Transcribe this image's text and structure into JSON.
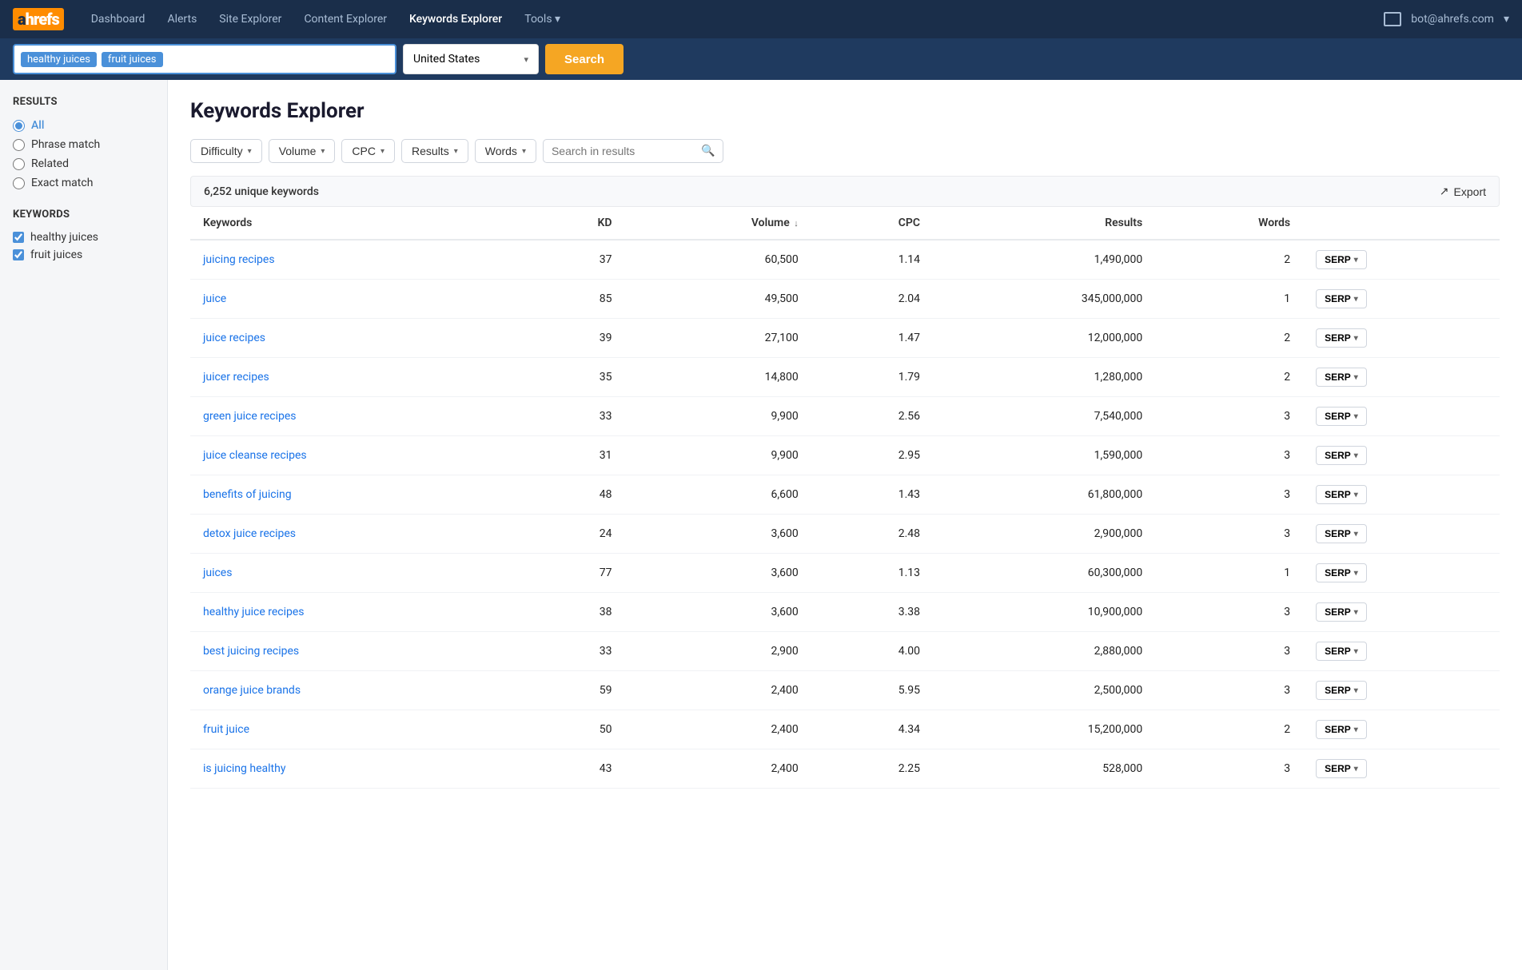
{
  "nav": {
    "logo": "ahrefs",
    "links": [
      {
        "label": "Dashboard",
        "active": false
      },
      {
        "label": "Alerts",
        "active": false
      },
      {
        "label": "Site Explorer",
        "active": false
      },
      {
        "label": "Content Explorer",
        "active": false
      },
      {
        "label": "Keywords Explorer",
        "active": true
      },
      {
        "label": "Tools",
        "active": false,
        "hasDropdown": true
      }
    ],
    "user": "bot@ahrefs.com"
  },
  "searchbar": {
    "tags": [
      "healthy juices",
      "fruit juices"
    ],
    "country": "United States",
    "search_btn": "Search"
  },
  "sidebar": {
    "results_title": "Results",
    "results_options": [
      {
        "label": "All",
        "selected": true
      },
      {
        "label": "Phrase match",
        "selected": false
      },
      {
        "label": "Related",
        "selected": false
      },
      {
        "label": "Exact match",
        "selected": false
      }
    ],
    "keywords_title": "Keywords",
    "keywords": [
      {
        "label": "healthy juices",
        "checked": true
      },
      {
        "label": "fruit juices",
        "checked": true
      }
    ]
  },
  "main": {
    "title": "Keywords Explorer",
    "filters": [
      {
        "label": "Difficulty"
      },
      {
        "label": "Volume"
      },
      {
        "label": "CPC"
      },
      {
        "label": "Results"
      },
      {
        "label": "Words"
      }
    ],
    "search_in_results_placeholder": "Search in results",
    "results_count": "6,252 unique keywords",
    "export_btn": "Export",
    "columns": [
      "Keywords",
      "KD",
      "Volume",
      "CPC",
      "Results",
      "Words",
      ""
    ],
    "rows": [
      {
        "keyword": "juicing recipes",
        "kd": 37,
        "volume": "60,500",
        "cpc": "1.14",
        "results": "1,490,000",
        "words": 2
      },
      {
        "keyword": "juice",
        "kd": 85,
        "volume": "49,500",
        "cpc": "2.04",
        "results": "345,000,000",
        "words": 1
      },
      {
        "keyword": "juice recipes",
        "kd": 39,
        "volume": "27,100",
        "cpc": "1.47",
        "results": "12,000,000",
        "words": 2
      },
      {
        "keyword": "juicer recipes",
        "kd": 35,
        "volume": "14,800",
        "cpc": "1.79",
        "results": "1,280,000",
        "words": 2
      },
      {
        "keyword": "green juice recipes",
        "kd": 33,
        "volume": "9,900",
        "cpc": "2.56",
        "results": "7,540,000",
        "words": 3
      },
      {
        "keyword": "juice cleanse recipes",
        "kd": 31,
        "volume": "9,900",
        "cpc": "2.95",
        "results": "1,590,000",
        "words": 3
      },
      {
        "keyword": "benefits of juicing",
        "kd": 48,
        "volume": "6,600",
        "cpc": "1.43",
        "results": "61,800,000",
        "words": 3
      },
      {
        "keyword": "detox juice recipes",
        "kd": 24,
        "volume": "3,600",
        "cpc": "2.48",
        "results": "2,900,000",
        "words": 3
      },
      {
        "keyword": "juices",
        "kd": 77,
        "volume": "3,600",
        "cpc": "1.13",
        "results": "60,300,000",
        "words": 1
      },
      {
        "keyword": "healthy juice recipes",
        "kd": 38,
        "volume": "3,600",
        "cpc": "3.38",
        "results": "10,900,000",
        "words": 3
      },
      {
        "keyword": "best juicing recipes",
        "kd": 33,
        "volume": "2,900",
        "cpc": "4.00",
        "results": "2,880,000",
        "words": 3
      },
      {
        "keyword": "orange juice brands",
        "kd": 59,
        "volume": "2,400",
        "cpc": "5.95",
        "results": "2,500,000",
        "words": 3
      },
      {
        "keyword": "fruit juice",
        "kd": 50,
        "volume": "2,400",
        "cpc": "4.34",
        "results": "15,200,000",
        "words": 2
      },
      {
        "keyword": "is juicing healthy",
        "kd": 43,
        "volume": "2,400",
        "cpc": "2.25",
        "results": "528,000",
        "words": 3
      }
    ],
    "serp_btn": "SERP"
  }
}
